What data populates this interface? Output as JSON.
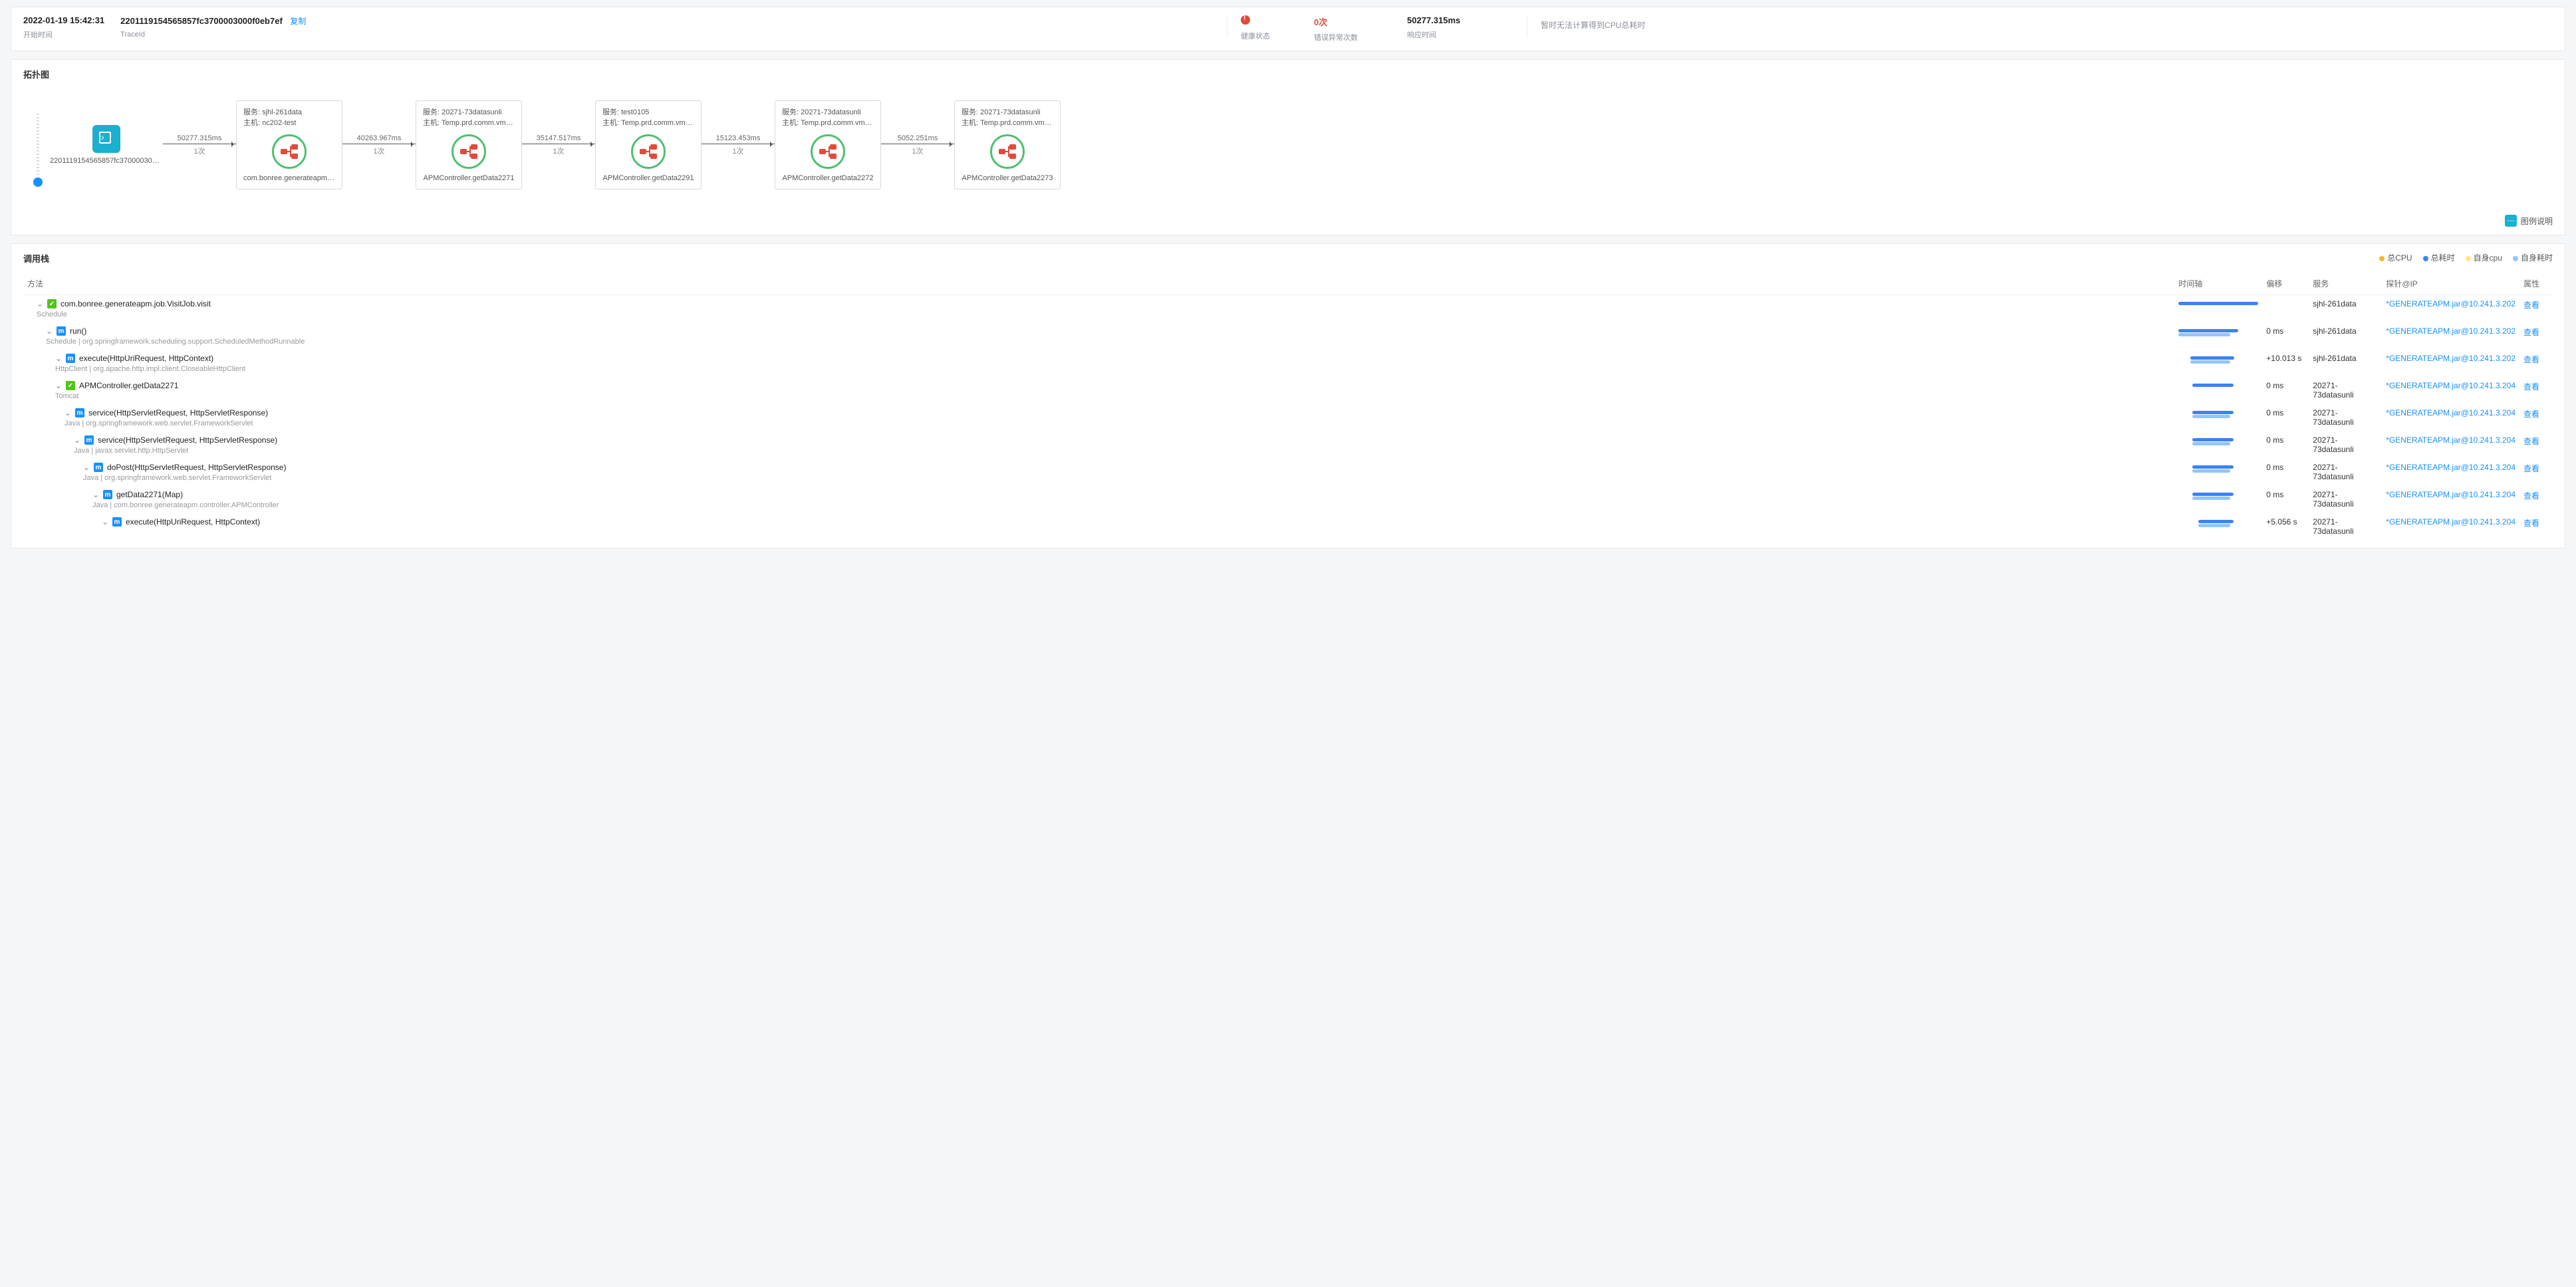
{
  "header": {
    "start_time": {
      "value": "2022-01-19 15:42:31",
      "label": "开始时间"
    },
    "trace_id": {
      "value": "2201119154565857fc3700003000f0eb7ef",
      "label": "TraceId",
      "copy": "复制"
    },
    "health": {
      "label": "健康状态"
    },
    "errors": {
      "value": "0次",
      "label": "错误异常次数"
    },
    "resp": {
      "value": "50277.315ms",
      "label": "响应时间"
    },
    "cpu_note": "暂时无法计算得到CPU总耗时"
  },
  "topo": {
    "title": "拓扑图",
    "root": {
      "id": "2201119154565857fc3700003000f0e..."
    },
    "edges": [
      {
        "ms": "50277.315ms",
        "count": "1次"
      },
      {
        "ms": "40263.967ms",
        "count": "1次"
      },
      {
        "ms": "35147.517ms",
        "count": "1次"
      },
      {
        "ms": "15123.453ms",
        "count": "1次"
      },
      {
        "ms": "5052.251ms",
        "count": "1次"
      }
    ],
    "nodes": [
      {
        "svc": "服务: sjhl-261data",
        "host": "主机: nc202-test",
        "method": "com.bonree.generateapm.job.Vis..."
      },
      {
        "svc": "服务: 20271-73datasunli",
        "host": "主机: Temp.prd.comm.vm.by.idc.b...",
        "method": "APMController.getData2271"
      },
      {
        "svc": "服务: test0105",
        "host": "主机: Temp.prd.comm.vm.by.idc.b...",
        "method": "APMController.getData2291"
      },
      {
        "svc": "服务: 20271-73datasunli",
        "host": "主机: Temp.prd.comm.vm.by.idc.b...",
        "method": "APMController.getData2272"
      },
      {
        "svc": "服务: 20271-73datasunli",
        "host": "主机: Temp.prd.comm.vm.by.idc.b...",
        "method": "APMController.getData2273"
      }
    ],
    "legend_btn": "图例说明"
  },
  "stack": {
    "title": "调用栈",
    "legend": {
      "total_cpu": "总CPU",
      "total_time": "总耗时",
      "self_cpu": "自身cpu",
      "self_time": "自身耗时"
    },
    "cols": {
      "method": "方法",
      "timeline": "时间轴",
      "offset": "偏移",
      "service": "服务",
      "probe": "探针@IP",
      "attr": "属性"
    },
    "view": "查看",
    "rows": [
      {
        "depth": 0,
        "badge": "g",
        "name": "com.bonree.generateapm.job.VisitJob.visit",
        "sub": "Schedule",
        "off": "",
        "svc": "sjhl-261data",
        "probe": "*GENERATEAPM.jar@10.241.3.202",
        "tl": {
          "l": 0,
          "w": 100,
          "h2": 0
        }
      },
      {
        "depth": 1,
        "badge": "b",
        "name": "run()",
        "sub": "Schedule | org.springframework.scheduling.support.ScheduledMethodRunnable",
        "off": "0 ms",
        "svc": "sjhl-261data",
        "probe": "*GENERATEAPM.jar@10.241.3.202",
        "tl": {
          "l": 0,
          "w": 75,
          "h2": 65
        }
      },
      {
        "depth": 2,
        "badge": "b",
        "name": "execute(HttpUriRequest, HttpContext)",
        "sub": "HttpClient | org.apache.http.impl.client.CloseableHttpClient",
        "off": "+10.013 s",
        "svc": "sjhl-261data",
        "probe": "*GENERATEAPM.jar@10.241.3.202",
        "tl": {
          "l": 15,
          "w": 55,
          "h2": 50
        }
      },
      {
        "depth": 2,
        "badge": "g",
        "name": "APMController.getData2271",
        "sub": "Tomcat",
        "off": "0 ms",
        "svc": "20271-73datasunli",
        "probe": "*GENERATEAPM.jar@10.241.3.204",
        "tl": {
          "l": 17,
          "w": 52,
          "h2": 0
        }
      },
      {
        "depth": 3,
        "badge": "b",
        "name": "service(HttpServletRequest, HttpServletResponse)",
        "sub": "Java | org.springframework.web.servlet.FrameworkServlet",
        "off": "0 ms",
        "svc": "20271-73datasunli",
        "probe": "*GENERATEAPM.jar@10.241.3.204",
        "tl": {
          "l": 17,
          "w": 52,
          "h2": 48
        }
      },
      {
        "depth": 4,
        "badge": "b",
        "name": "service(HttpServletRequest, HttpServletResponse)",
        "sub": "Java | javax.servlet.http.HttpServlet",
        "off": "0 ms",
        "svc": "20271-73datasunli",
        "probe": "*GENERATEAPM.jar@10.241.3.204",
        "tl": {
          "l": 17,
          "w": 52,
          "h2": 48
        }
      },
      {
        "depth": 5,
        "badge": "b",
        "name": "doPost(HttpServletRequest, HttpServletResponse)",
        "sub": "Java | org.springframework.web.servlet.FrameworkServlet",
        "off": "0 ms",
        "svc": "20271-73datasunli",
        "probe": "*GENERATEAPM.jar@10.241.3.204",
        "tl": {
          "l": 17,
          "w": 52,
          "h2": 48
        }
      },
      {
        "depth": 6,
        "badge": "b",
        "name": "getData2271(Map)",
        "sub": "Java | com.bonree.generateapm.controller.APMController",
        "off": "0 ms",
        "svc": "20271-73datasunli",
        "probe": "*GENERATEAPM.jar@10.241.3.204",
        "tl": {
          "l": 17,
          "w": 52,
          "h2": 48
        }
      },
      {
        "depth": 7,
        "badge": "b",
        "name": "execute(HttpUriRequest, HttpContext)",
        "sub": "",
        "off": "+5.056 s",
        "svc": "20271-73datasunli",
        "probe": "*GENERATEAPM.jar@10.241.3.204",
        "tl": {
          "l": 25,
          "w": 44,
          "h2": 40
        }
      }
    ]
  }
}
